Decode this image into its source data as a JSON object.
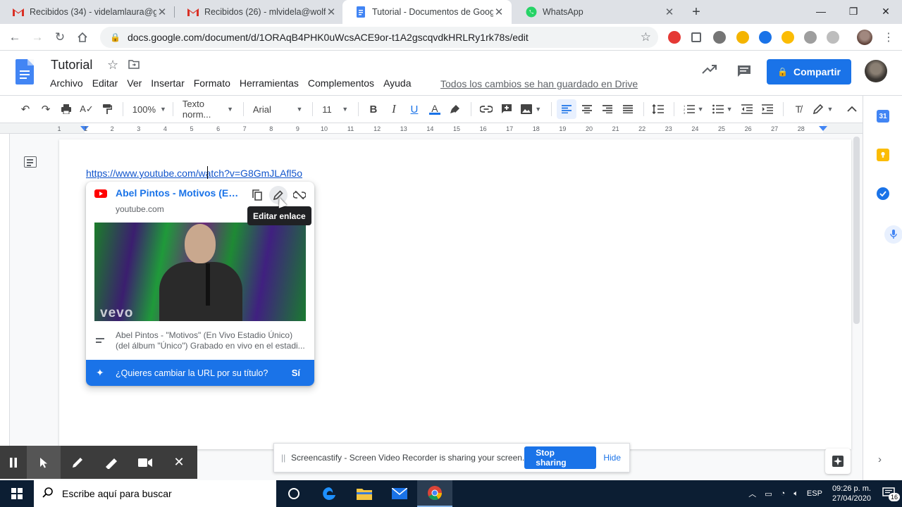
{
  "browser": {
    "tabs": [
      {
        "title": "Recibidos (34) - videlamlaura@g...",
        "icon": "gmail-icon"
      },
      {
        "title": "Recibidos (26) - mlvidela@wolfs...",
        "icon": "gmail-icon"
      },
      {
        "title": "Tutorial - Documentos de Googl...",
        "icon": "docs-icon",
        "active": true
      },
      {
        "title": "WhatsApp",
        "icon": "whatsapp-icon"
      }
    ],
    "url": "docs.google.com/document/d/1ORAqB4PHK0uWcsACE9or-t1A2gscqvdkHRLRy1rk78s/edit"
  },
  "docs": {
    "title": "Tutorial",
    "menu": [
      "Archivo",
      "Editar",
      "Ver",
      "Insertar",
      "Formato",
      "Herramientas",
      "Complementos",
      "Ayuda"
    ],
    "saved_status": "Todos los cambios se han guardado en Drive",
    "share_label": "Compartir"
  },
  "toolbar": {
    "zoom": "100%",
    "style": "Texto norm...",
    "font": "Arial",
    "size": "11",
    "bold": "B",
    "italic": "I",
    "underline": "U",
    "text_color": "A"
  },
  "ruler": {
    "ticks": [
      "1",
      "1",
      "2",
      "3",
      "4",
      "5",
      "6",
      "7",
      "8",
      "9",
      "10",
      "11",
      "12",
      "13",
      "14",
      "15",
      "16",
      "17",
      "18",
      "19",
      "20",
      "21",
      "22",
      "23",
      "24",
      "25",
      "26",
      "27",
      "28"
    ]
  },
  "document": {
    "link_text": "https://www.youtube.com/watch?v=G8GmJLAfl5o"
  },
  "link_card": {
    "title": "Abel Pintos - Motivos (En ...",
    "domain": "youtube.com",
    "thumbnail_text": "vevo",
    "description_line1": "Abel Pintos - \"Motivos\" (En Vivo Estadio Único)",
    "description_line2": "(del álbum \"Único\") Grabado en vivo en el estadi...",
    "convert_question": "¿Quieres cambiar la URL por su título?",
    "convert_yes": "Sí"
  },
  "tooltip": "Editar enlace",
  "side_panel": {
    "calendar_day": "31"
  },
  "screencastify": {
    "message": "Screencastify - Screen Video Recorder is sharing your screen.",
    "stop_label": "Stop sharing",
    "hide_label": "Hide"
  },
  "taskbar": {
    "search_placeholder": "Escribe aquí para buscar",
    "language": "ESP",
    "time": "09:26 p. m.",
    "date": "27/04/2020",
    "notifications": "16"
  },
  "colors": {
    "accent": "#1a73e8",
    "link": "#1155cc",
    "youtube": "#ff0000",
    "taskbar": "#0c1e33"
  }
}
